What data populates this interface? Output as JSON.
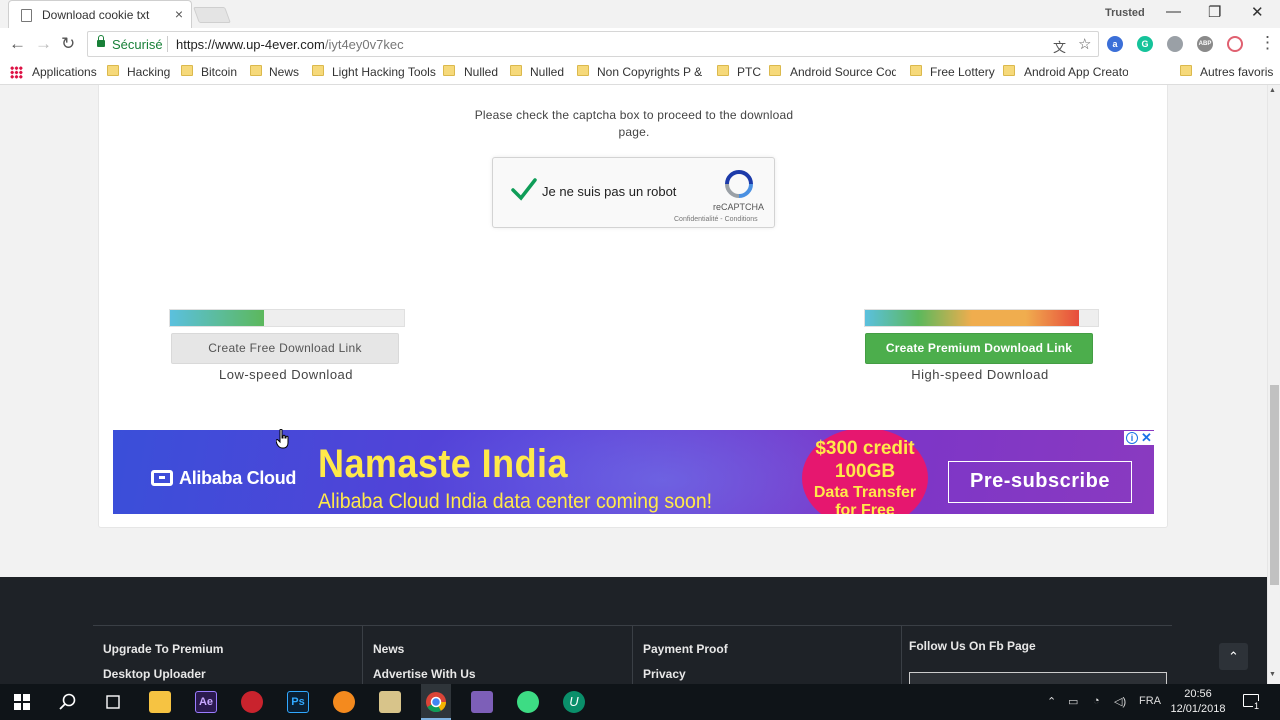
{
  "browser": {
    "tab_title": "Download cookie txt",
    "tab_close": "×",
    "trusted_label": "Trusted",
    "security_label": "Sécurisé",
    "url_host": "https://www.up-4ever.com",
    "url_path": "/iyt4ey0v7kec",
    "window_minimize": "—",
    "window_restore": "❐",
    "window_close": "✕",
    "nav_back": "←",
    "nav_forward": "→",
    "nav_reload": "↻",
    "menu": "⋮",
    "bookmark_star": "☆",
    "translate_icon": "文"
  },
  "bookmarks": {
    "apps_label": "Applications",
    "items": [
      "Hacking",
      "Bitcoin",
      "News",
      "Light Hacking Tools",
      "Nulled",
      "Nulled",
      "Non Copyrights P & ",
      "PTC",
      "Android Source Code",
      "Free Lottery",
      "Android App Creator"
    ],
    "other_label": "Autres favoris"
  },
  "download": {
    "captcha_prompt": "Please check the captcha box to proceed to the download page.",
    "recaptcha_label": "Je ne suis pas un robot",
    "recaptcha_brand": "reCAPTCHA",
    "recaptcha_links": "Confidentialité - Conditions",
    "free_button": "Create Free Download Link",
    "free_speed_label": "Low-speed Download",
    "free_bar_fraction": 0.4,
    "premium_button": "Create Premium Download Link",
    "premium_speed_label": "High-speed Download",
    "premium_bar_fraction": 0.92
  },
  "ad": {
    "brand": "Alibaba Cloud",
    "headline": "Namaste India",
    "subline": "Alibaba Cloud India data center coming soon!",
    "offer_line1": "$300 credit",
    "offer_line2": "100GB",
    "offer_line3": "Data Transfer",
    "offer_line4": "for Free",
    "cta": "Pre-subscribe",
    "info_icon": "i",
    "close_icon": "✕"
  },
  "footer": {
    "col1": [
      "Upgrade To Premium",
      "Desktop Uploader"
    ],
    "col2": [
      "News",
      "Advertise With Us"
    ],
    "col3": [
      "Payment Proof",
      "Privacy"
    ],
    "col4_title": "Follow Us On Fb Page",
    "back_to_top": "⌃"
  },
  "taskbar": {
    "language": "FRA",
    "time": "20:56",
    "date": "12/01/2018",
    "notification_count": "1"
  },
  "colors": {
    "premium_green": "#4cae4c",
    "secure_green": "#188038",
    "ad_yellow": "#ffe94a",
    "ad_pink": "#e6176f"
  }
}
